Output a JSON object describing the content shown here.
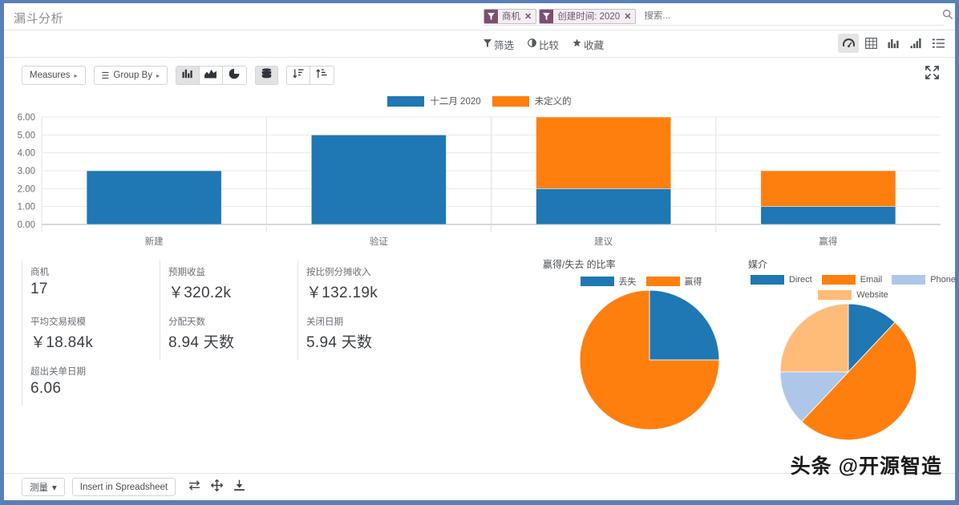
{
  "window": {
    "title": "漏斗分析"
  },
  "search": {
    "placeholder": "搜索...",
    "facets": [
      {
        "label": "商机",
        "icon": "filter-icon",
        "remove": "✕"
      },
      {
        "label": "创建时间: 2020",
        "icon": "filter-icon",
        "remove": "✕"
      }
    ],
    "magnifier_icon": "search-icon"
  },
  "menubar": {
    "items": [
      {
        "label": "筛选",
        "icon": "filter-icon"
      },
      {
        "label": "比较",
        "icon": "contrast-icon"
      },
      {
        "label": "收藏",
        "icon": "star-icon"
      }
    ],
    "views": [
      {
        "name": "graph-view",
        "icon": "gauge-icon",
        "active": true
      },
      {
        "name": "pivot-view",
        "icon": "table-icon",
        "active": false
      },
      {
        "name": "bar-view",
        "icon": "bar-chart-icon",
        "active": false
      },
      {
        "name": "area-view",
        "icon": "signal-icon",
        "active": false
      },
      {
        "name": "list-view",
        "icon": "list-icon",
        "active": false
      }
    ]
  },
  "toolbar": {
    "measures_label": "Measures",
    "measures_caret": "▸",
    "groupby_label": "Group By",
    "groupby_caret": "▸",
    "groupby_ham": "☰",
    "chart_types": [
      {
        "name": "bar-chart-button",
        "icon": "bar-chart-icon",
        "active": true
      },
      {
        "name": "line-chart-button",
        "icon": "area-chart-icon",
        "active": false
      },
      {
        "name": "pie-chart-button",
        "icon": "pie-chart-icon",
        "active": false
      }
    ],
    "stack_button": {
      "name": "stacked-button",
      "icon": "database-icon",
      "active": true
    },
    "sort_asc_button": {
      "name": "sort-ascending-button",
      "icon": "sort-desc-icon"
    },
    "sort_desc_button": {
      "name": "sort-descending-button",
      "icon": "sort-asc-icon"
    },
    "expand_button": {
      "name": "fullscreen-button",
      "icon": "expand-icon"
    }
  },
  "chart_data": {
    "type": "bar",
    "title": "",
    "xlabel": "",
    "ylabel": "",
    "stacked": true,
    "grid": true,
    "legend_position": "top",
    "categories": [
      "新建",
      "验证",
      "建议",
      "赢得"
    ],
    "ylim": [
      0,
      6
    ],
    "yticks": [
      "0.00",
      "1.00",
      "2.00",
      "3.00",
      "4.00",
      "5.00",
      "6.00"
    ],
    "series": [
      {
        "name": "十二月 2020",
        "color": "#1f77b4",
        "values": [
          3,
          5,
          2,
          1
        ]
      },
      {
        "name": "未定义的",
        "color": "#ff7f0e",
        "values": [
          0,
          0,
          4,
          2
        ]
      }
    ]
  },
  "kpis": [
    {
      "label": "商机",
      "value": "17"
    },
    {
      "label": "预期收益",
      "value": "￥320.2k"
    },
    {
      "label": "按比例分摊收入",
      "value": "￥132.19k"
    },
    {
      "label": "平均交易规模",
      "value": "￥18.84k"
    },
    {
      "label": "分配天数",
      "value": "8.94 天数"
    },
    {
      "label": "关闭日期",
      "value": "5.94 天数"
    },
    {
      "label": "超出关单日期",
      "value": "6.06"
    }
  ],
  "pies": [
    {
      "title": "赢得/失去 的比率",
      "type": "pie",
      "labels": [
        "丢失",
        "赢得"
      ],
      "values": [
        25,
        75
      ],
      "colors": [
        "#1f77b4",
        "#ff7f0e"
      ]
    },
    {
      "title": "媒介",
      "type": "pie",
      "labels": [
        "Direct",
        "Email",
        "Phone",
        "Website"
      ],
      "values": [
        12,
        50,
        13,
        25
      ],
      "colors": [
        "#1f77b4",
        "#ff7f0e",
        "#aec7e8",
        "#ffbb78"
      ]
    }
  ],
  "bottombar": {
    "measure_label": "测量",
    "measure_caret": "▾",
    "spreadsheet_label": "Insert in Spreadsheet",
    "icons": [
      {
        "name": "swap-axis-button",
        "glyph": "⇄"
      },
      {
        "name": "expand-all-button",
        "glyph": "✛"
      },
      {
        "name": "download-button",
        "glyph": "⤓"
      }
    ]
  },
  "watermark": {
    "text": "头条 @开源智造"
  }
}
